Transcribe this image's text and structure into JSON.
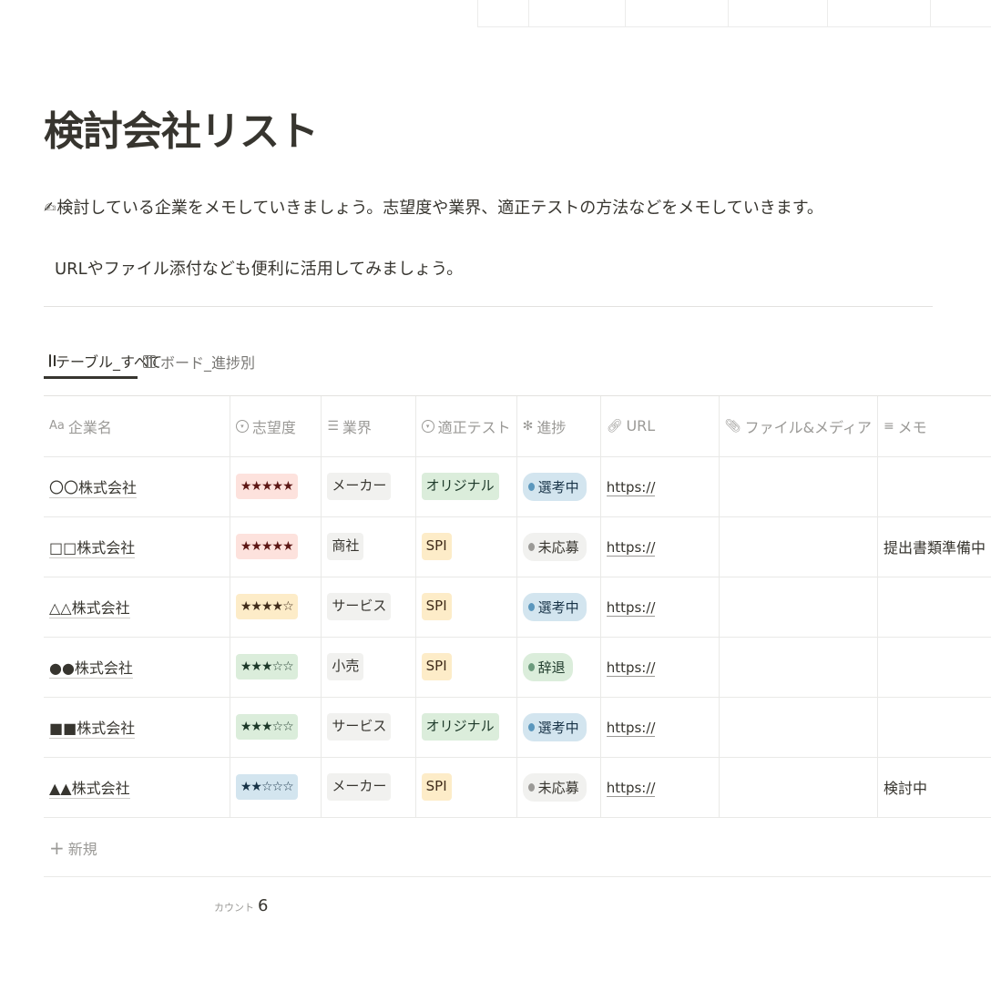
{
  "page": {
    "title": "検討会社リスト",
    "description_line1": "検討している企業をメモしていきましょう。志望度や業界、適正テストの方法などをメモしていきます。",
    "description_line2": "URLやファイル添付なども便利に活用してみましょう。",
    "emoji_icon": "writing-hand-icon"
  },
  "views": [
    {
      "label": "テーブル_すべて",
      "icon": "table-icon",
      "active": true
    },
    {
      "label": "ボード_進捗別",
      "icon": "board-icon",
      "active": false
    }
  ],
  "table": {
    "columns": [
      {
        "label": "企業名",
        "icon": "Aa"
      },
      {
        "label": "志望度",
        "icon": "select-icon"
      },
      {
        "label": "業界",
        "icon": "list-icon"
      },
      {
        "label": "適正テスト",
        "icon": "select-icon"
      },
      {
        "label": "進捗",
        "icon": "status-icon"
      },
      {
        "label": "URL",
        "icon": "link-icon"
      },
      {
        "label": "ファイル&メディア",
        "icon": "paperclip-icon"
      },
      {
        "label": "メモ",
        "icon": "text-icon"
      }
    ],
    "rows": [
      {
        "name": "〇〇株式会社",
        "priority": "★★★★★",
        "priority_color": "#fde2dd",
        "industry": "メーカー",
        "test": "オリジナル",
        "test_color": "#dbeddb",
        "progress": "選考中",
        "progress_color": "#d3e5ef",
        "url": "https://",
        "memo": ""
      },
      {
        "name": "□□株式会社",
        "priority": "★★★★★",
        "priority_color": "#fde2dd",
        "industry": "商社",
        "test": "SPI",
        "test_color": "#fdecc8",
        "progress": "未応募",
        "progress_color": "#f1f1ef",
        "url": "https://",
        "memo": "提出書類準備中"
      },
      {
        "name": "△△株式会社",
        "priority": "★★★★☆",
        "priority_color": "#fdecc8",
        "industry": "サービス",
        "test": "SPI",
        "test_color": "#fdecc8",
        "progress": "選考中",
        "progress_color": "#d3e5ef",
        "url": "https://",
        "memo": ""
      },
      {
        "name": "●●株式会社",
        "priority": "★★★☆☆",
        "priority_color": "#dbeddb",
        "industry": "小売",
        "test": "SPI",
        "test_color": "#fdecc8",
        "progress": "辞退",
        "progress_color": "#dbeddb",
        "url": "https://",
        "memo": ""
      },
      {
        "name": "■■株式会社",
        "priority": "★★★☆☆",
        "priority_color": "#dbeddb",
        "industry": "サービス",
        "test": "オリジナル",
        "test_color": "#dbeddb",
        "progress": "選考中",
        "progress_color": "#d3e5ef",
        "url": "https://",
        "memo": ""
      },
      {
        "name": "▲▲株式会社",
        "priority": "★★☆☆☆",
        "priority_color": "#d3e5ef",
        "industry": "メーカー",
        "test": "SPI",
        "test_color": "#fdecc8",
        "progress": "未応募",
        "progress_color": "#f1f1ef",
        "url": "https://",
        "memo": "検討中"
      }
    ],
    "new_row_label": "新規",
    "count_label": "カウント",
    "count_value": "6"
  }
}
